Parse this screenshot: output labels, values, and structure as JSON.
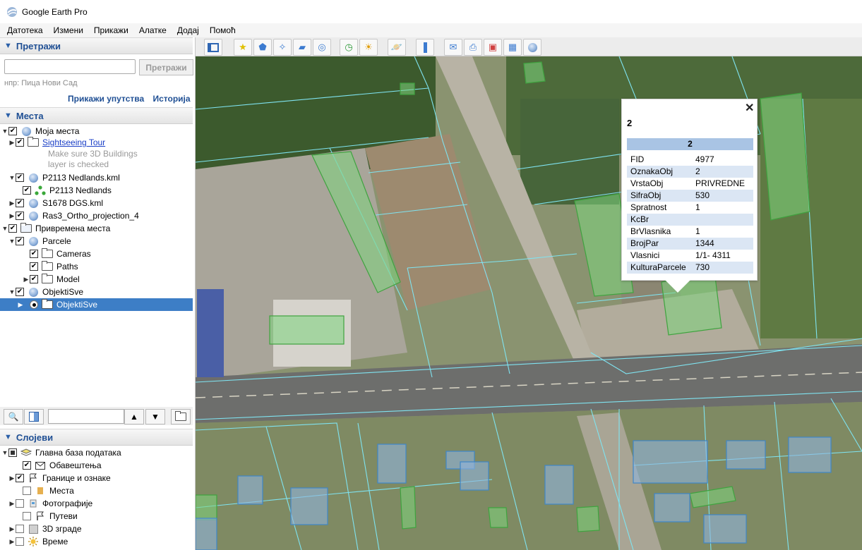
{
  "window": {
    "title": "Google Earth Pro"
  },
  "menu": [
    "Датотека",
    "Измени",
    "Прикажи",
    "Алатке",
    "Додај",
    "Помоћ"
  ],
  "search": {
    "header": "Претражи",
    "button": "Претражи",
    "hint": "нпр: Пица Нови Сад",
    "show_directions": "Прикажи упутства",
    "history": "Историја"
  },
  "places": {
    "header": "Места",
    "items": [
      {
        "label": "Моја места",
        "type": "globe"
      },
      {
        "label": "Sightseeing Tour",
        "type": "folder",
        "link": true
      },
      {
        "label": "Make sure 3D Buildings",
        "type": "note"
      },
      {
        "label": "layer is checked",
        "type": "note"
      },
      {
        "label": "P2113 Nedlands.kml",
        "type": "globe"
      },
      {
        "label": "P2113 Nedlands",
        "type": "shape"
      },
      {
        "label": "S1678 DGS.kml",
        "type": "globe"
      },
      {
        "label": "Ras3_Ortho_projection_4",
        "type": "globe"
      },
      {
        "label": "Привремена места",
        "type": "folder-open"
      },
      {
        "label": "Parcele",
        "type": "globe"
      },
      {
        "label": "Cameras",
        "type": "folder"
      },
      {
        "label": "Paths",
        "type": "folder"
      },
      {
        "label": "Model",
        "type": "folder"
      },
      {
        "label": "ObjektiSve",
        "type": "globe"
      },
      {
        "label": "ObjektiSve",
        "type": "folder",
        "selected": true
      }
    ]
  },
  "layers": {
    "header": "Слојеви",
    "items": [
      {
        "label": "Главна база података"
      },
      {
        "label": "Обавештења"
      },
      {
        "label": "Границе и ознаке"
      },
      {
        "label": "Места"
      },
      {
        "label": "Фотографије"
      },
      {
        "label": "Путеви"
      },
      {
        "label": "3D зграде"
      },
      {
        "label": "Време"
      }
    ]
  },
  "balloon": {
    "title": "2",
    "header": "2",
    "rows": [
      {
        "key": "FID",
        "value": "4977"
      },
      {
        "key": "OznakaObj",
        "value": "2"
      },
      {
        "key": "VrstaObj",
        "value": "PRIVREDNE"
      },
      {
        "key": "SifraObj",
        "value": "530"
      },
      {
        "key": "Spratnost",
        "value": "1"
      },
      {
        "key": "KcBr",
        "value": ""
      },
      {
        "key": "BrVlasnika",
        "value": "1"
      },
      {
        "key": "BrojPar",
        "value": "1344"
      },
      {
        "key": "Vlasnici",
        "value": "1/1- 4311"
      },
      {
        "key": "KulturaParcele",
        "value": "730"
      }
    ]
  },
  "colors": {
    "accent": "#1f4f94",
    "selection": "#3d7ec6",
    "parcel_line": "#7fe3f0",
    "building_green": "#7ed67e",
    "building_blue": "#8fb4de"
  }
}
